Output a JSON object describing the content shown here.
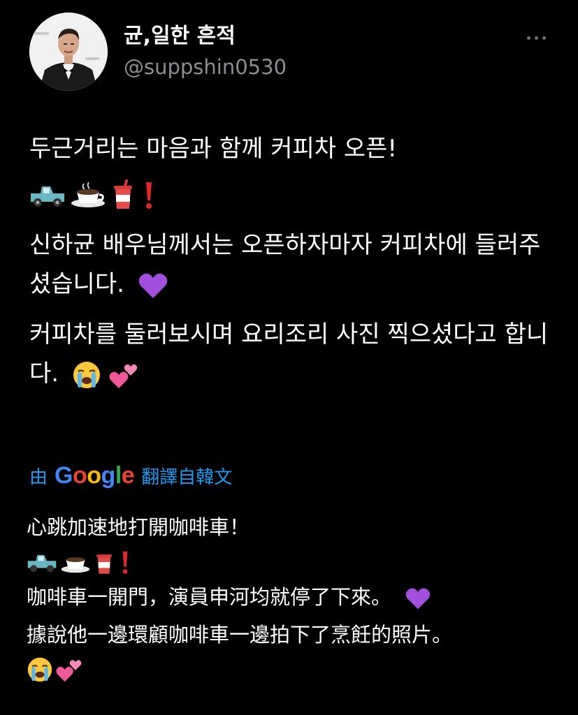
{
  "user": {
    "display_name": "균,일한 흔적",
    "handle": "@suppshin0530"
  },
  "tweet": {
    "line1": "두근거리는 마음과 함께 커피차 오픈!",
    "line2": "신하균 배우님께서는 오픈하자마자 커피차에 들러주셨습니다.",
    "line3": "커피차를 둘러보시며 요리조리 사진 찍으셨다고 합니다."
  },
  "translation": {
    "prefix": "由",
    "provider": "Google",
    "suffix": "翻譯自韓文",
    "line1": "心跳加速地打開咖啡車！",
    "line2": "咖啡車一開門，演員申河均就停了下來。",
    "line3": "據說他一邊環顧咖啡車一邊拍下了烹飪的照片。"
  },
  "emojis": [
    "pickup-truck",
    "hot-coffee",
    "cup-with-straw",
    "red-exclamation",
    "purple-heart",
    "loudly-crying-face",
    "two-hearts"
  ],
  "colors": {
    "background": "#000000",
    "text": "#ffffff",
    "handle": "#8b8f94",
    "link": "#1d9bf0",
    "google_blue": "#4285f4",
    "google_red": "#ea4335",
    "google_yellow": "#fbbc05",
    "google_green": "#34a853"
  }
}
